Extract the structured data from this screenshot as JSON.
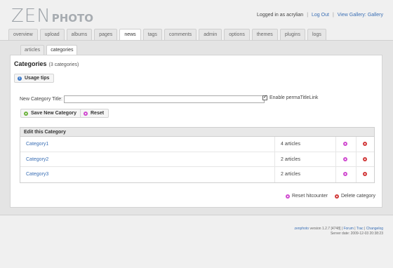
{
  "logo": {
    "part1": "ZEN",
    "part2": "PHOTO"
  },
  "userbar": {
    "logged_in": "Logged in as acrylian",
    "logout": "Log Out",
    "view_gallery": "View Gallery: Gallery",
    "sep": "|"
  },
  "tabs": [
    "overview",
    "upload",
    "albums",
    "pages",
    "news",
    "tags",
    "comments",
    "admin",
    "options",
    "themes",
    "plugins",
    "logs"
  ],
  "subtabs": [
    "articles",
    "categories"
  ],
  "heading": {
    "title": "Categories",
    "count": "(3 categories)"
  },
  "buttons": {
    "usage_tips": "Usage tips",
    "save": "Save New Category",
    "reset": "Reset",
    "info_glyph": "i"
  },
  "form": {
    "title_label": "New Category Title:",
    "title_value": "",
    "permalink_label": "Enable permaTitleLink"
  },
  "table": {
    "header": "Edit this Category",
    "rows": [
      {
        "name": "Category1",
        "count": "4 articles"
      },
      {
        "name": "Category2",
        "count": "2 articles"
      },
      {
        "name": "Category3",
        "count": "2 articles"
      }
    ]
  },
  "legend": {
    "reset_hitcounter": "Reset hitcounter",
    "delete_category": "Delete category"
  },
  "footer": {
    "brand": "zenphoto",
    "version": " version 1.2.7 [4748] | ",
    "forum": "Forum",
    "trac": "Trac",
    "changelog": "Changelog",
    "pipe": " | ",
    "server_date": "Server date: 2009-12-03 20:38:23"
  },
  "colors": {
    "link": "#3a6fb5",
    "info": "#3a78c8",
    "save": "#6db33f",
    "reset": "#d04ad0",
    "delete": "#d23b3b"
  }
}
